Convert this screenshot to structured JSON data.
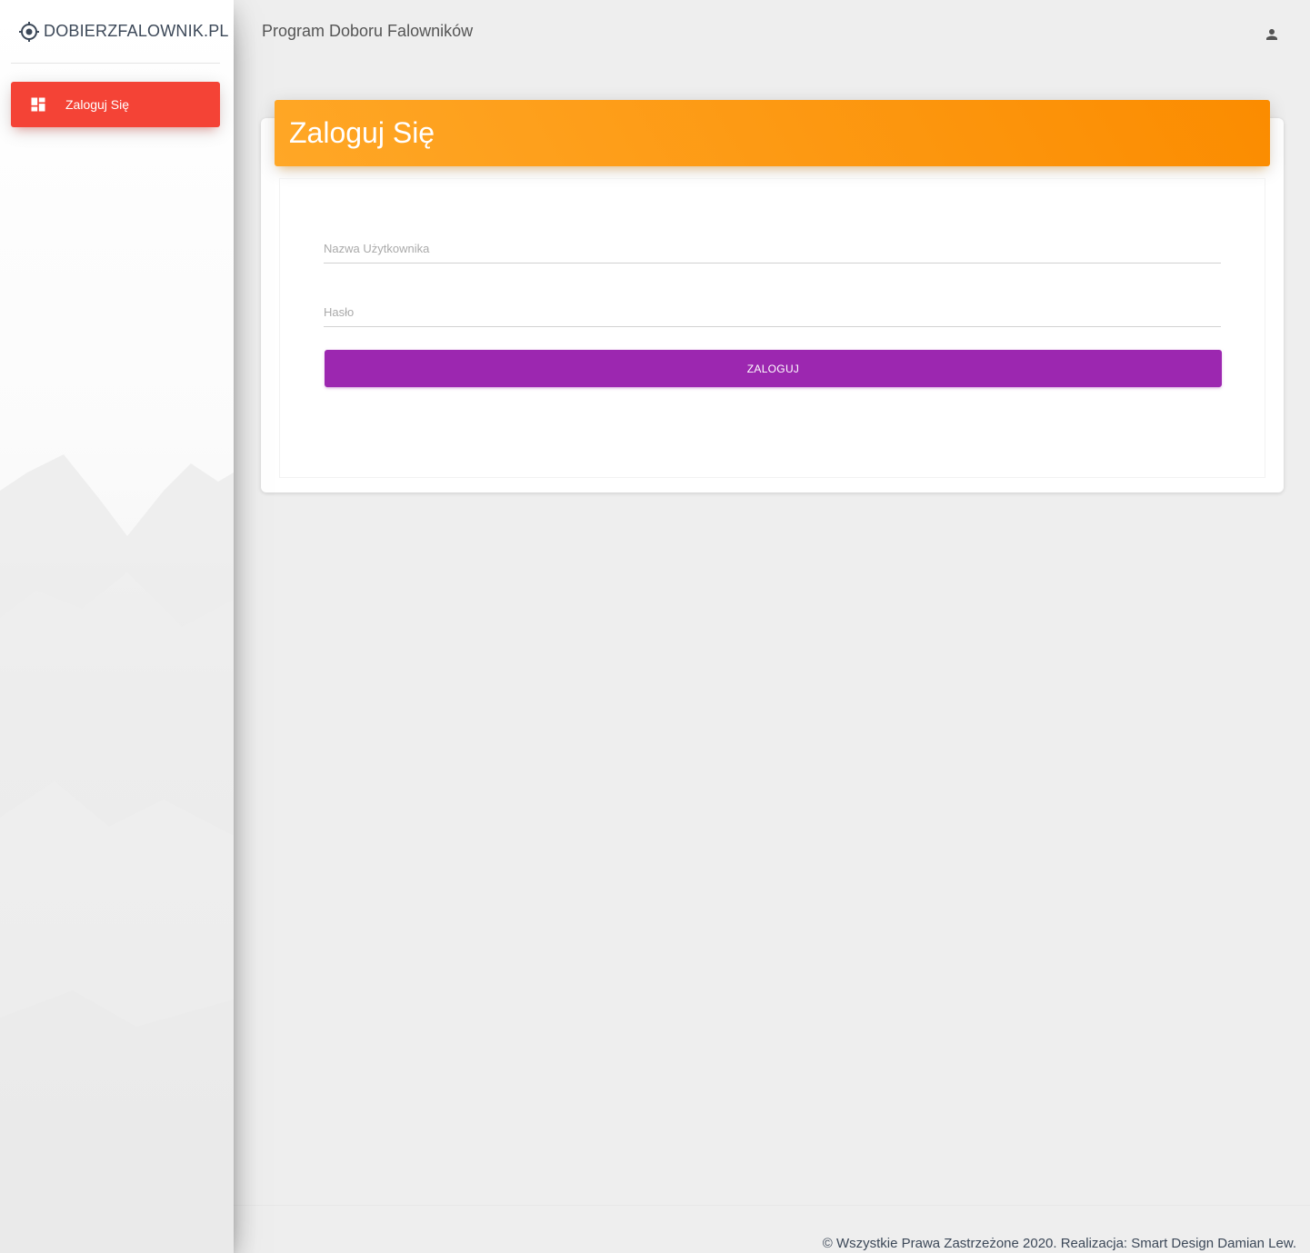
{
  "brand": {
    "name": "DOBIERZFALOWNIK.PL",
    "icon": "crosshair-icon"
  },
  "sidebar": {
    "items": [
      {
        "label": "Zaloguj Się",
        "icon": "dashboard-icon",
        "active": true,
        "color": "#f44336"
      }
    ]
  },
  "topbar": {
    "title": "Program Doboru Falowników",
    "user_icon": "person-icon"
  },
  "login_card": {
    "title": "Zaloguj Się",
    "header_color": "#fb8c00",
    "username_placeholder": "Nazwa Użytkownika",
    "username_value": "",
    "password_placeholder": "Hasło",
    "password_value": "",
    "submit_label": "ZALOGUJ",
    "submit_color": "#9c27b0"
  },
  "footer": {
    "copyright": "© Wszystkie Prawa Zastrzeżone 2020. Realizacja: Smart Design Damian Lew."
  }
}
